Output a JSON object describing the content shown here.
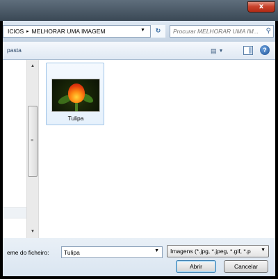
{
  "window": {
    "close_glyph": "x",
    "accent": "#c8432c"
  },
  "address": {
    "crumbs": [
      "ICIOS",
      "MELHORAR UMA IMAGEM"
    ],
    "separator": "▸",
    "dropdown_icon": "chevron-down-icon",
    "refresh_glyph": "↻"
  },
  "search": {
    "placeholder": "Procurar MELHORAR UMA IM...",
    "icon": "search-icon"
  },
  "toolbar": {
    "new_folder_label": "pasta",
    "views_icon": "views-icon",
    "help_glyph": "?"
  },
  "files": [
    {
      "name": "Tulipa",
      "thumbnail": "tulip-image"
    }
  ],
  "bottom": {
    "filename_label": "eme do ficheiro:",
    "filename_value": "Tulipa",
    "filetype_value": "Imagens (*.jpg, *.jpeg, *.gif, *.p",
    "open_label": "Abrir",
    "cancel_label": "Cancelar"
  }
}
